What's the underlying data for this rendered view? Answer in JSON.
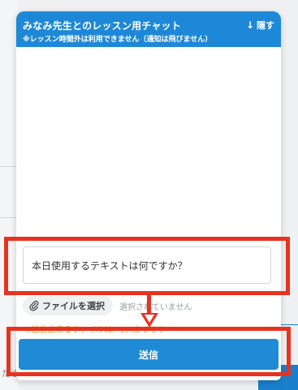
{
  "chat": {
    "title": "みなみ先生とのレッスン用チャット",
    "subtitle": "※レッスン時間外は利用できません（通知は飛びません）",
    "hide_label": "隠す",
    "hide_icon": "arrow-down-icon",
    "message_value": "本日使用するテキストは何ですか？",
    "file_button_label": "ファイルを選択",
    "file_button_icon": "paperclip-icon",
    "file_status": "選択されていません",
    "file_note": "※送信出来るファイルは、2Mまでです",
    "send_label": "送信"
  },
  "background": {
    "partial_text": "ださい"
  },
  "colors": {
    "header": "#1e88d8",
    "send_button": "#1f8bd6",
    "annotation": "#e8321f",
    "note": "#e8a317"
  }
}
